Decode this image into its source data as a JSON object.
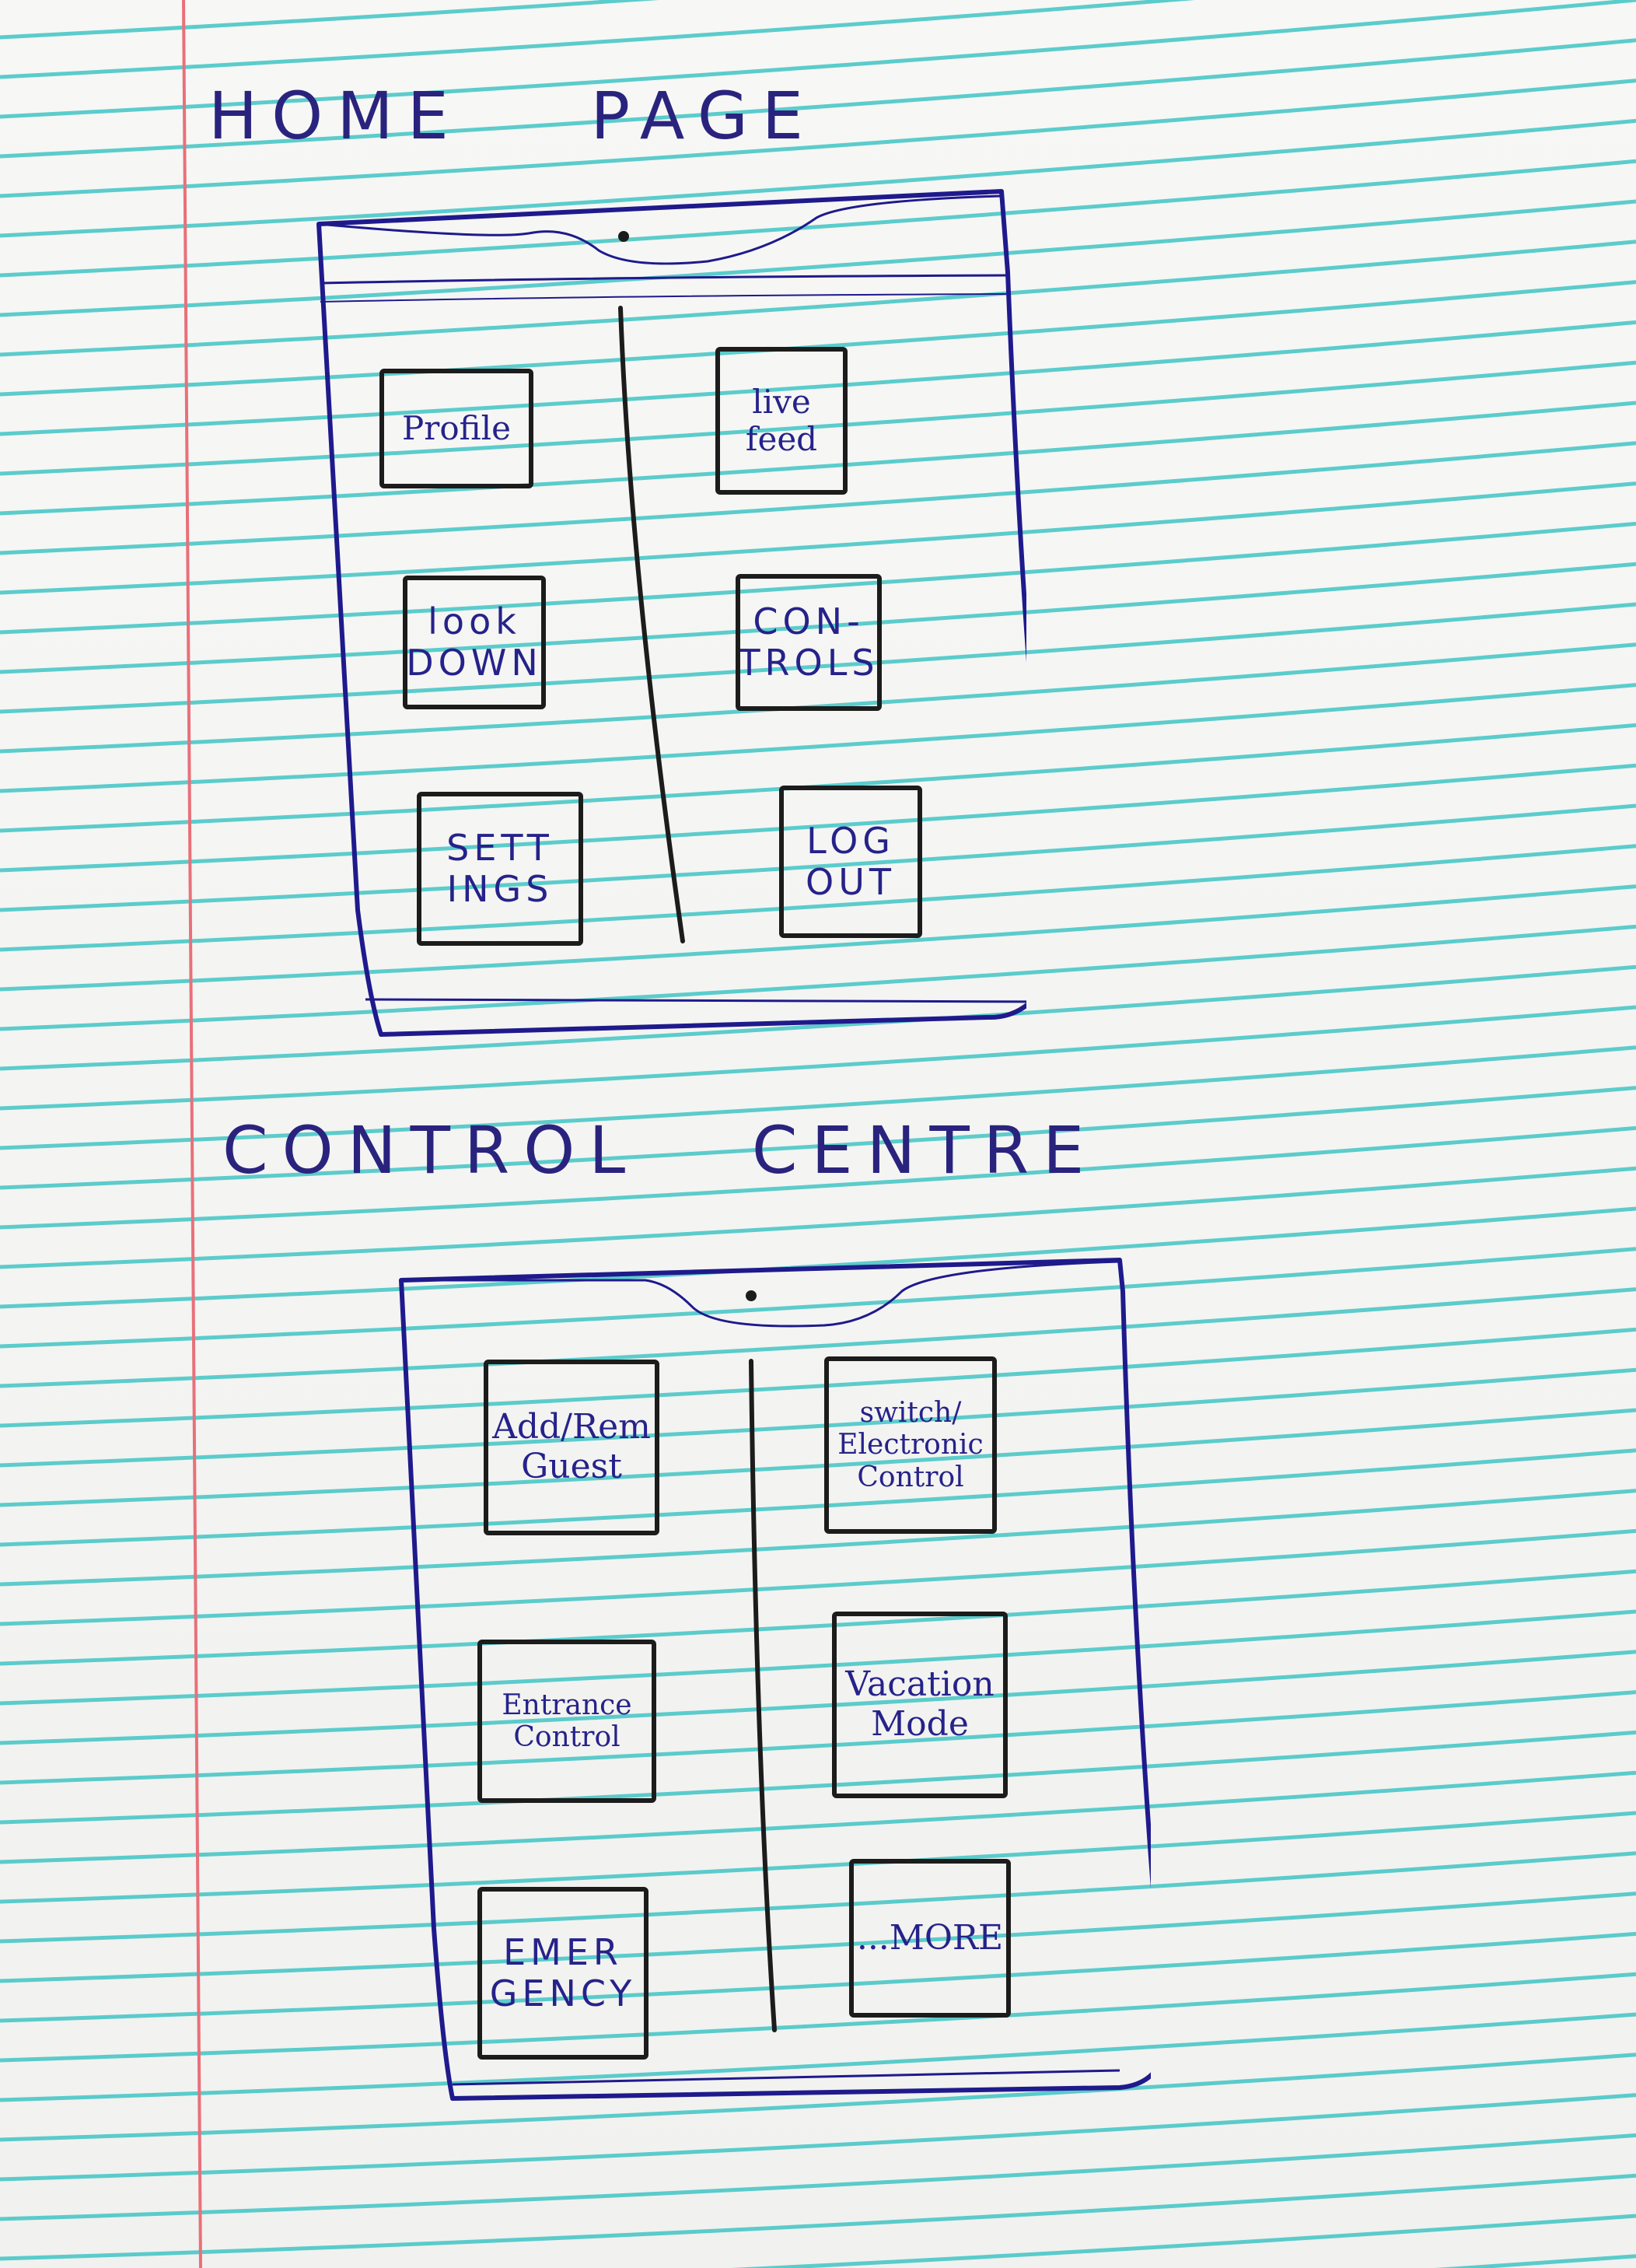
{
  "home_page": {
    "title_words": [
      "HOME",
      "PAGE"
    ],
    "tiles": [
      {
        "lines": [
          "Profile"
        ]
      },
      {
        "lines": [
          "live",
          "feed"
        ]
      },
      {
        "lines": [
          "look",
          "DOWN"
        ]
      },
      {
        "lines": [
          "CON-",
          "TROLS"
        ]
      },
      {
        "lines": [
          "SETT",
          "INGS"
        ]
      },
      {
        "lines": [
          "LOG",
          "OUT"
        ]
      }
    ]
  },
  "control_centre": {
    "title_words": [
      "CONTROL",
      "CENTRE"
    ],
    "tiles": [
      {
        "lines": [
          "Add/Rem",
          "Guest"
        ]
      },
      {
        "lines": [
          "switch/",
          "Electronic",
          "Control"
        ]
      },
      {
        "lines": [
          "Entrance",
          "Control"
        ]
      },
      {
        "lines": [
          "Vacation",
          "Mode"
        ]
      },
      {
        "lines": [
          "EMER",
          "GENCY"
        ]
      },
      {
        "lines": [
          "...MORE"
        ]
      }
    ]
  },
  "colors": {
    "paper": "#f4f4f2",
    "ruled_line": "#3fc4c4",
    "margin_line": "#e8707a",
    "pen_blue": "#2a237e",
    "frame_blue": "#1f1a8c",
    "tile_ink": "#1c1c1c"
  }
}
